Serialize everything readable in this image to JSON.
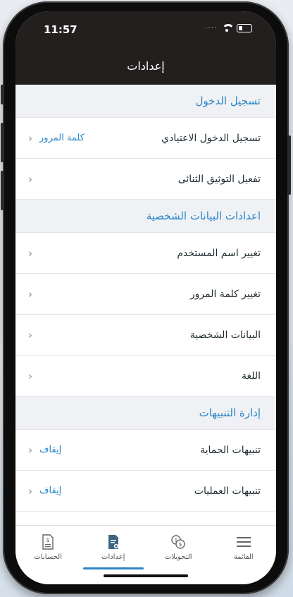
{
  "status": {
    "time": "11:57"
  },
  "nav": {
    "title": "إعدادات"
  },
  "sections": [
    {
      "title": "تسجيل الدخول",
      "items": [
        {
          "label": "تسجيل الدخول الاعتيادي",
          "value": "كلمة المرور"
        },
        {
          "label": "تفعيل التوثيق الثنائى",
          "value": ""
        }
      ]
    },
    {
      "title": "اعدادات البيانات الشخصية",
      "items": [
        {
          "label": "تغيير اسم المستخدم",
          "value": ""
        },
        {
          "label": "تغيير كلمة المرور",
          "value": ""
        },
        {
          "label": "البيانات الشخصية",
          "value": ""
        },
        {
          "label": "اللغة",
          "value": ""
        }
      ]
    },
    {
      "title": "إدارة التنبيهات",
      "items": [
        {
          "label": "تنبيهات الحماية",
          "value": "إيقاف"
        },
        {
          "label": "تنبيهات العمليات",
          "value": "إيقاف"
        }
      ]
    }
  ],
  "chevron": "‹",
  "tabbar": {
    "items": [
      {
        "label": "القائمة",
        "icon": "menu-icon"
      },
      {
        "label": "التحويلات",
        "icon": "transfer-icon"
      },
      {
        "label": "إعدادات",
        "icon": "settings-doc-icon",
        "active": true
      },
      {
        "label": "الحسابات",
        "icon": "accounts-doc-icon"
      }
    ]
  },
  "colors": {
    "accent": "#2b86c8",
    "header": "#231f1f",
    "section_bg": "#eff1f4"
  }
}
